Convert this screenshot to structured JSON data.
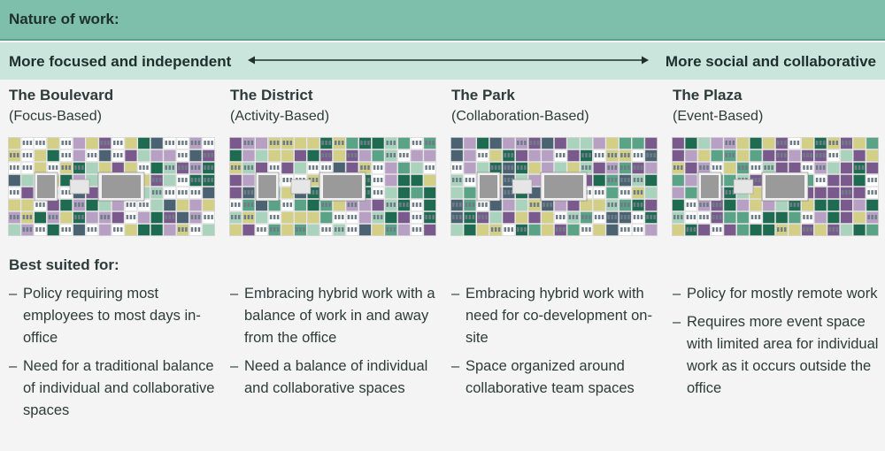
{
  "header": {
    "title": "Nature of work:"
  },
  "spectrum": {
    "left_label": "More focused and independent",
    "right_label": "More social and collaborative"
  },
  "colors": {
    "header_bg": "#7dbfaa",
    "spectrum_bg": "#c9e5dc",
    "dark_green": "#1f6b52",
    "mid_green": "#5aa387",
    "light_green": "#a9d3bd",
    "purple": "#7a5a8c",
    "light_purple": "#b7a0c4",
    "olive": "#d3cf86",
    "slate": "#4b6272",
    "core_gray": "#9a9a9a"
  },
  "best_suited_label": "Best suited for:",
  "columns": [
    {
      "name": "The Boulevard",
      "subtitle": "(Focus-Based)",
      "bullets": [
        "Policy requiring most employees to most days in-office",
        "Need for a traditional balance of individual and collaborative spaces"
      ]
    },
    {
      "name": "The District",
      "subtitle": "(Activity-Based)",
      "bullets": [
        "Embracing hybrid work with a balance of work in and away from the office",
        "Need a balance of individual and collaborative spaces"
      ]
    },
    {
      "name": "The Park",
      "subtitle": "(Collaboration-Based)",
      "bullets": [
        "Embracing hybrid work with need for co-development on-site",
        "Space organized around collaborative team spaces"
      ]
    },
    {
      "name": "The Plaza",
      "subtitle": "(Event-Based)",
      "bullets": [
        "Policy for mostly remote work",
        "Requires more event space with limited area for individual work as it occurs outside the office"
      ]
    }
  ]
}
